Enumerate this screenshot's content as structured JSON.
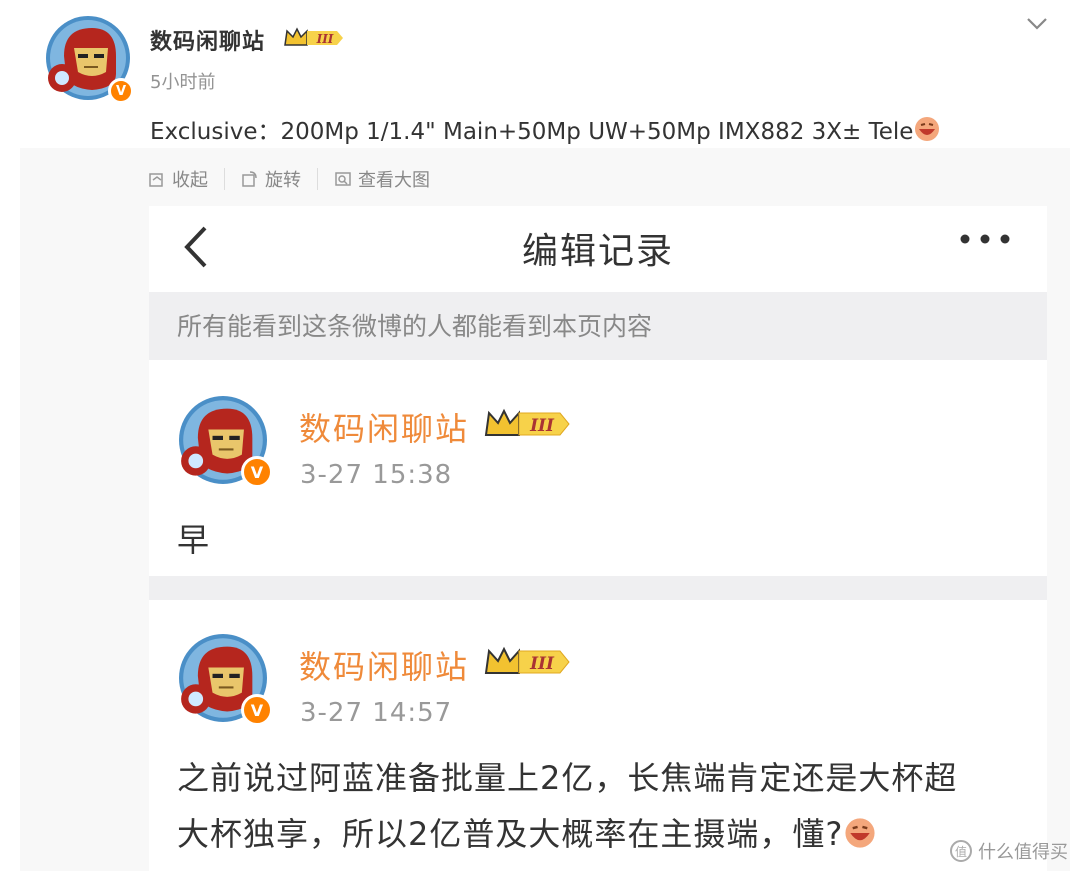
{
  "post": {
    "author": "数码闲聊站",
    "level_badge": "III",
    "time": "5小时前",
    "text_prefix": "Exclusive：200Mp 1/1.4\" Main+50Mp UW+50Mp IMX882 3X± Tele",
    "verified_mark": "V"
  },
  "toolbar": {
    "collapse": "收起",
    "rotate": "旋转",
    "view_large": "查看大图"
  },
  "screenshot": {
    "title": "编辑记录",
    "notice": "所有能看到这条微博的人都能看到本页内容",
    "records": [
      {
        "author": "数码闲聊站",
        "level_badge": "III",
        "time": "3-27 15:38",
        "lines": [
          "早"
        ]
      },
      {
        "author": "数码闲聊站",
        "level_badge": "III",
        "time": "3-27 14:57",
        "lines": [
          "之前说过阿蓝准备批量上2亿，长焦端肯定还是大杯超",
          "大杯独享，所以2亿普及大概率在主摄端，懂?"
        ]
      }
    ]
  },
  "watermark": {
    "icon": "值",
    "text": "什么值得买"
  },
  "colors": {
    "orange_name": "#ef8a3a",
    "verified": "#ff8200",
    "notice_bg": "#efeff1"
  }
}
